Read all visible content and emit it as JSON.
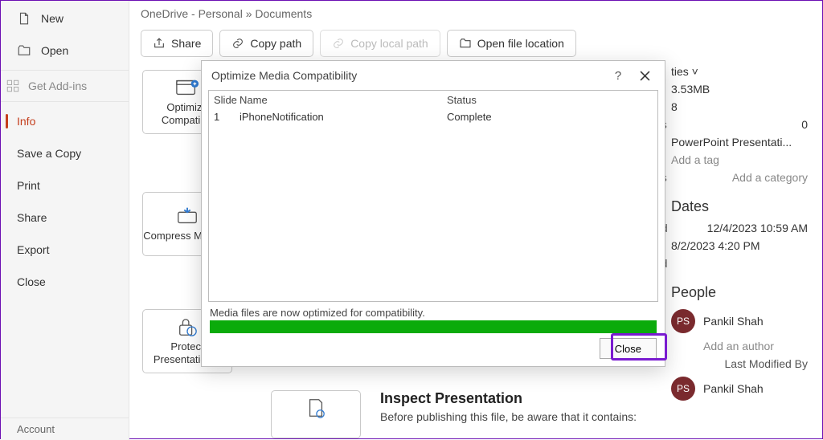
{
  "sidebar": {
    "new": "New",
    "open": "Open",
    "addins": "Get Add-ins",
    "info": "Info",
    "saveCopy": "Save a Copy",
    "print": "Print",
    "share": "Share",
    "export": "Export",
    "close": "Close",
    "account": "Account"
  },
  "breadcrumb": "OneDrive - Personal » Documents",
  "toolbar": {
    "share": "Share",
    "copyPath": "Copy path",
    "copyLocal": "Copy local path",
    "openLoc": "Open file location"
  },
  "cards": {
    "optimize": "Optimize Compatibili",
    "compress": "Compress Media ˅",
    "protect": "Protect Presentation ˅"
  },
  "inspect": {
    "title": "Inspect Presentation",
    "sub": "Before publishing this file, be aware that it contains:"
  },
  "props": {
    "tiesLabel": "ties ˅",
    "size": "3.53MB",
    "slidesCount": "8",
    "lidesLabel": "lides",
    "hidden": "0",
    "format": "PowerPoint Presentati...",
    "addTag": "Add a tag",
    "esLabel": "es",
    "addCat": "Add a category"
  },
  "dates": {
    "head": "Dates",
    "ifiedLabel": "ified",
    "modified": "12/4/2023 10:59 AM",
    "created": "8/2/2023 4:20 PM",
    "tedLabel": "ted"
  },
  "people": {
    "head": "People",
    "initials": "PS",
    "name": "Pankil Shah",
    "addAuthor": "Add an author",
    "lastModBy": "Last Modified By"
  },
  "dialog": {
    "title": "Optimize Media Compatibility",
    "cols": {
      "slide": "Slide",
      "name": "Name",
      "status": "Status"
    },
    "row": {
      "slide": "1",
      "name": "iPhoneNotification",
      "status": "Complete"
    },
    "msg": "Media files are now optimized for compatibility.",
    "close": "Close"
  }
}
